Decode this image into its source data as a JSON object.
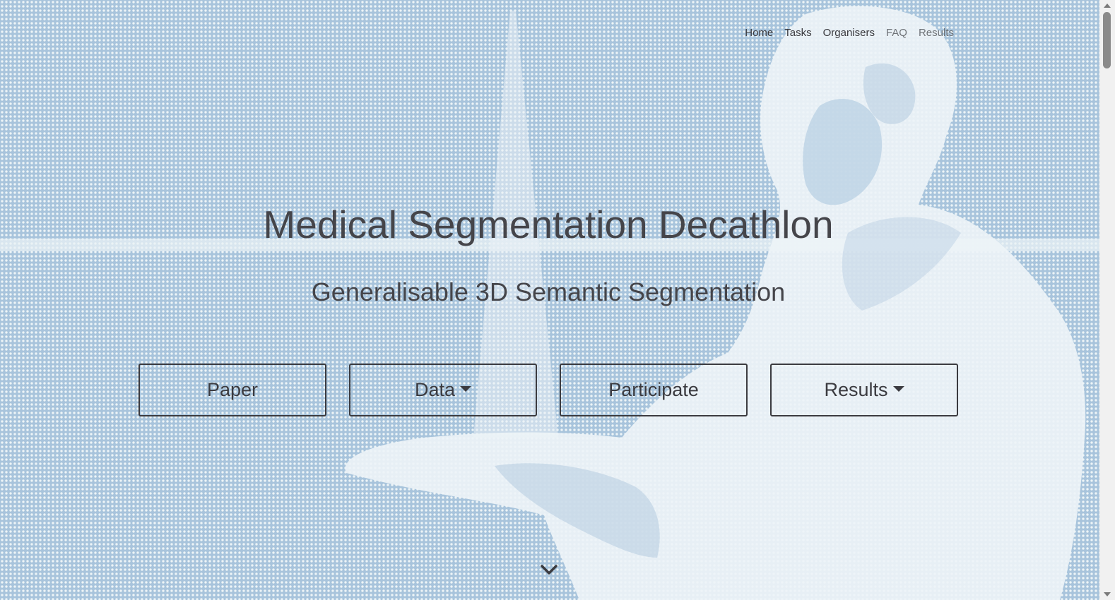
{
  "nav": {
    "items": [
      {
        "label": "Home"
      },
      {
        "label": "Tasks"
      },
      {
        "label": "Organisers"
      },
      {
        "label": "FAQ"
      },
      {
        "label": "Results"
      }
    ]
  },
  "hero": {
    "title": "Medical Segmentation Decathlon",
    "subtitle": "Generalisable 3D Semantic Segmentation"
  },
  "buttons": {
    "paper": "Paper",
    "data": "Data",
    "participate": "Participate",
    "results": "Results"
  },
  "icons": {
    "scroll_down": "chevron-down-icon",
    "dropdown": "caret-down-icon"
  },
  "colors": {
    "background_dots": "#a8c4dc",
    "background_light": "#edf4f7",
    "text": "#45454a",
    "button_border": "#3b3b40"
  }
}
